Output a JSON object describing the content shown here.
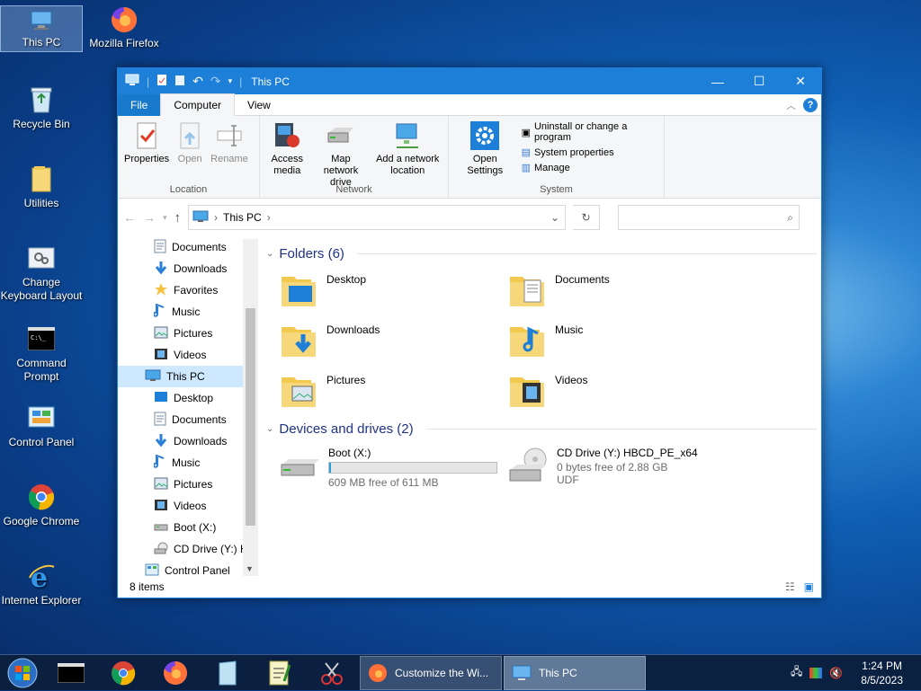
{
  "desktop": {
    "icons": [
      {
        "label": "This PC",
        "icon": "this-pc-icon"
      },
      {
        "label": "Mozilla Firefox",
        "icon": "firefox-icon"
      },
      {
        "label": "Recycle Bin",
        "icon": "recycle-bin-icon"
      },
      {
        "label": "Utilities",
        "icon": "folder-icon"
      },
      {
        "label": "Change Keyboard Layout",
        "icon": "keyboard-icon"
      },
      {
        "label": "Command Prompt",
        "icon": "cmd-icon"
      },
      {
        "label": "Control Panel",
        "icon": "control-panel-icon"
      },
      {
        "label": "Google Chrome",
        "icon": "chrome-icon"
      },
      {
        "label": "Internet Explorer",
        "icon": "ie-icon"
      }
    ]
  },
  "window": {
    "title": "This PC",
    "tabs": {
      "file": "File",
      "computer": "Computer",
      "view": "View"
    },
    "ribbon": {
      "location": {
        "label": "Location",
        "properties": "Properties",
        "open": "Open",
        "rename": "Rename"
      },
      "network": {
        "label": "Network",
        "access_media": "Access media",
        "map_drive": "Map network drive",
        "add_location": "Add a network location"
      },
      "system": {
        "label": "System",
        "open_settings": "Open Settings",
        "uninstall": "Uninstall or change a program",
        "system_properties": "System properties",
        "manage": "Manage"
      }
    },
    "address": {
      "path": "This PC",
      "search_placeholder": ""
    },
    "nav_items": [
      {
        "label": "Documents",
        "icon": "documents-icon",
        "indent": 1
      },
      {
        "label": "Downloads",
        "icon": "downloads-icon",
        "indent": 1
      },
      {
        "label": "Favorites",
        "icon": "star-icon",
        "indent": 1
      },
      {
        "label": "Music",
        "icon": "music-icon",
        "indent": 1
      },
      {
        "label": "Pictures",
        "icon": "pictures-icon",
        "indent": 1
      },
      {
        "label": "Videos",
        "icon": "videos-icon",
        "indent": 1
      },
      {
        "label": "This PC",
        "icon": "this-pc-icon",
        "indent": 0,
        "selected": true
      },
      {
        "label": "Desktop",
        "icon": "desktop-icon",
        "indent": 1
      },
      {
        "label": "Documents",
        "icon": "documents-icon",
        "indent": 1
      },
      {
        "label": "Downloads",
        "icon": "downloads-icon",
        "indent": 1
      },
      {
        "label": "Music",
        "icon": "music-icon",
        "indent": 1
      },
      {
        "label": "Pictures",
        "icon": "pictures-icon",
        "indent": 1
      },
      {
        "label": "Videos",
        "icon": "videos-icon",
        "indent": 1
      },
      {
        "label": "Boot (X:)",
        "icon": "drive-icon",
        "indent": 1
      },
      {
        "label": "CD Drive (Y:) H",
        "icon": "cd-icon",
        "indent": 1
      },
      {
        "label": "Control Panel",
        "icon": "control-panel-icon",
        "indent": 0
      }
    ],
    "folders_header": "Folders (6)",
    "folders": [
      "Desktop",
      "Documents",
      "Downloads",
      "Music",
      "Pictures",
      "Videos"
    ],
    "drives_header": "Devices and drives (2)",
    "drives": [
      {
        "name": "Boot (X:)",
        "info": "609 MB free of 611 MB",
        "used_fraction": 0.003
      },
      {
        "name": "CD Drive (Y:) HBCD_PE_x64",
        "info": "0 bytes free of 2.88 GB",
        "fs": "UDF"
      }
    ],
    "status": "8 items"
  },
  "taskbar": {
    "window1": "Customize the Wi...",
    "window2": "This PC",
    "time": "1:24 PM",
    "date": "8/5/2023"
  }
}
